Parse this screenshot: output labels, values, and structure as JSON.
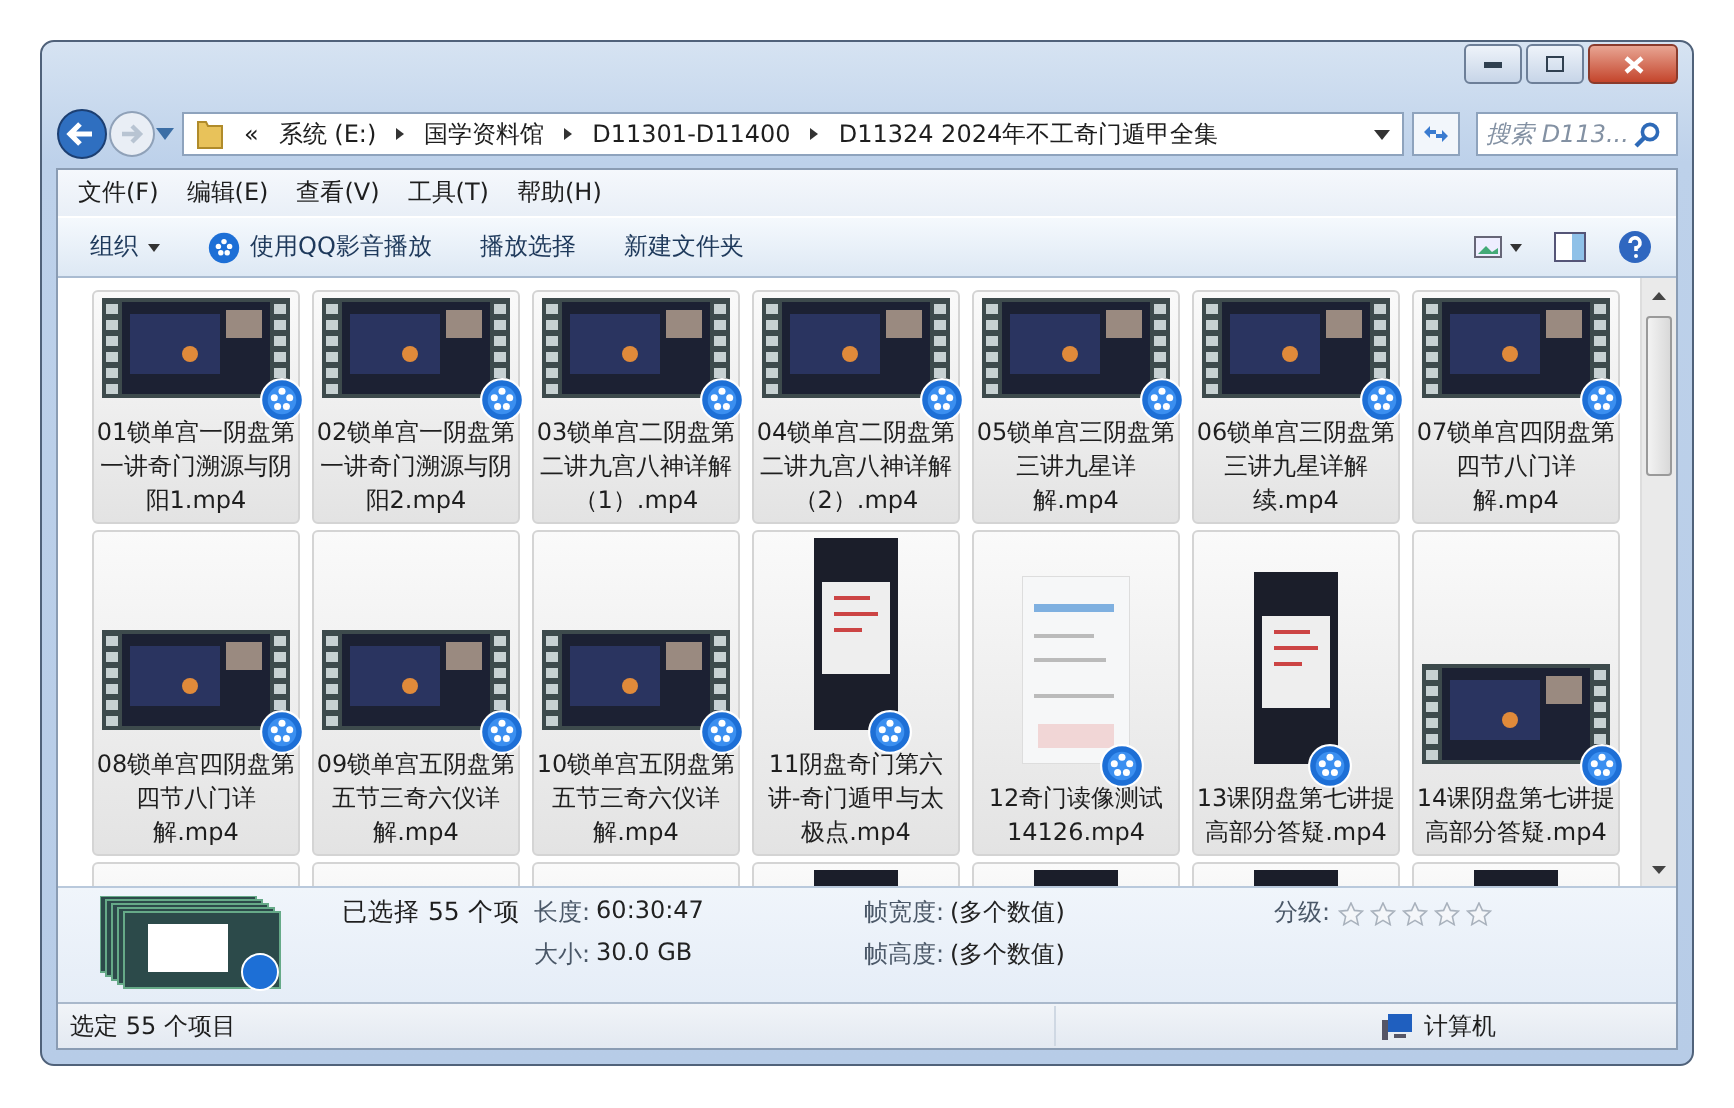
{
  "address": {
    "overflow": "«",
    "crumbs": [
      "系统 (E:)",
      "国学资料馆",
      "D11301-D11400",
      "D11324 2024年不工奇门遁甲全集"
    ]
  },
  "search": {
    "placeholder": "搜索 D113..."
  },
  "menu": [
    "文件(F)",
    "编辑(E)",
    "查看(V)",
    "工具(T)",
    "帮助(H)"
  ],
  "toolbar": [
    {
      "label": "组织",
      "kind": "dropdown"
    },
    {
      "label": "使用QQ影音播放",
      "kind": "player"
    },
    {
      "label": "播放选择",
      "kind": "plain"
    },
    {
      "label": "新建文件夹",
      "kind": "plain"
    }
  ],
  "files": [
    {
      "name": "01锁单宫一阴盘第一讲奇门溯源与阴阳1.mp4",
      "kind": "wide",
      "selected": true
    },
    {
      "name": "02锁单宫一阴盘第一讲奇门溯源与阴阳2.mp4",
      "kind": "wide",
      "selected": true
    },
    {
      "name": "03锁单宫二阴盘第二讲九宫八神详解（1）.mp4",
      "kind": "wide",
      "selected": true
    },
    {
      "name": "04锁单宫二阴盘第二讲九宫八神详解（2）.mp4",
      "kind": "wide",
      "selected": true
    },
    {
      "name": "05锁单宫三阴盘第三讲九星详解.mp4",
      "kind": "wide",
      "selected": true
    },
    {
      "name": "06锁单宫三阴盘第三讲九星详解续.mp4",
      "kind": "wide",
      "selected": true
    },
    {
      "name": "07锁单宫四阴盘第四节八门详解.mp4",
      "kind": "wide",
      "selected": true
    },
    {
      "name": "08锁单宫四阴盘第四节八门详解.mp4",
      "kind": "wide",
      "selected": true
    },
    {
      "name": "09锁单宫五阴盘第五节三奇六仪详解.mp4",
      "kind": "wide",
      "selected": true
    },
    {
      "name": "10锁单宫五阴盘第五节三奇六仪详解.mp4",
      "kind": "wide",
      "selected": true
    },
    {
      "name": "11阴盘奇门第六讲-奇门遁甲与太极点.mp4",
      "kind": "tall",
      "selected": true
    },
    {
      "name": "12奇门读像测试14126.mp4",
      "kind": "phone",
      "selected": true
    },
    {
      "name": "13课阴盘第七讲提高部分答疑.mp4",
      "kind": "tall",
      "selected": true
    },
    {
      "name": "14课阴盘第七讲提高部分答疑.mp4",
      "kind": "wide",
      "selected": true
    },
    {
      "kind": "doc",
      "selected": true
    },
    {
      "kind": "doc",
      "selected": true
    },
    {
      "kind": "blank",
      "selected": true
    },
    {
      "kind": "tall",
      "selected": true
    },
    {
      "kind": "tall",
      "selected": true
    },
    {
      "kind": "tall",
      "selected": true
    },
    {
      "kind": "tall",
      "selected": true
    }
  ],
  "details": {
    "selection": "已选择 55 个项",
    "fields": [
      {
        "label": "长度:",
        "value": "60:30:47"
      },
      {
        "label": "帧宽度:",
        "value": "(多个数值)"
      },
      {
        "label": "大小:",
        "value": "30.0 GB"
      },
      {
        "label": "帧高度:",
        "value": "(多个数值)"
      }
    ],
    "rating": {
      "label": "分级:",
      "stars": 0
    }
  },
  "status": {
    "text": "选定 55 个项目",
    "location": "计算机"
  }
}
